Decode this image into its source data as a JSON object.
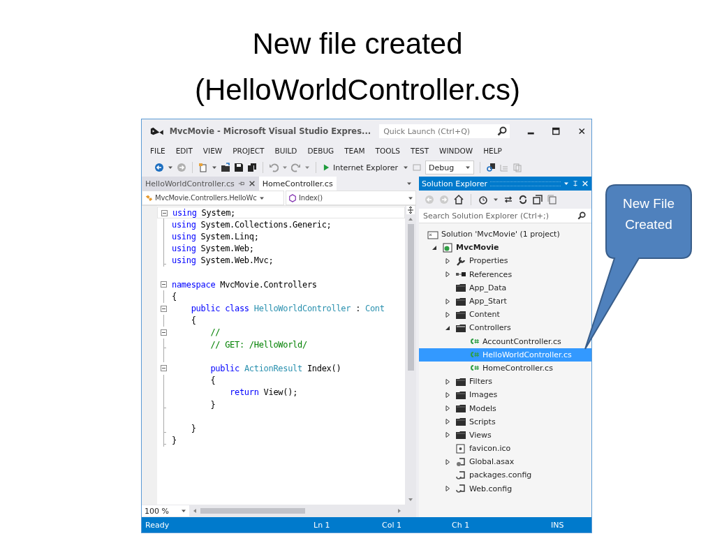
{
  "slide_title": [
    "New file created",
    "(HelloWorldController.cs)"
  ],
  "callout": "New File Created",
  "window": {
    "title": "MvcMovie - Microsoft Visual Studio Expres...",
    "quick_launch": {
      "placeholder": "Quick Launch (Ctrl+Q)"
    }
  },
  "menu": [
    "FILE",
    "EDIT",
    "VIEW",
    "PROJECT",
    "BUILD",
    "DEBUG",
    "TEAM",
    "TOOLS",
    "TEST",
    "WINDOW",
    "HELP"
  ],
  "toolbar": {
    "browser": "Internet Explorer",
    "configuration": "Debug"
  },
  "editor": {
    "tabs": [
      {
        "label": "HelloWorldController.cs",
        "selected": true
      },
      {
        "label": "HomeController.cs",
        "selected": false
      }
    ],
    "nav": {
      "type": "MvcMovie.Controllers.HelloWc",
      "member": "Index()"
    },
    "lines": [
      {
        "kind": "start",
        "tokens": [
          {
            "kind": "kw",
            "text": "using"
          },
          {
            "kind": "plain",
            "text": " System;"
          }
        ]
      },
      {
        "kind": "mid",
        "tokens": [
          {
            "kind": "kw",
            "text": "using"
          },
          {
            "kind": "plain",
            "text": " System.Collections.Generic;"
          }
        ]
      },
      {
        "kind": "mid",
        "tokens": [
          {
            "kind": "kw",
            "text": "using"
          },
          {
            "kind": "plain",
            "text": " System.Linq;"
          }
        ]
      },
      {
        "kind": "mid",
        "tokens": [
          {
            "kind": "kw",
            "text": "using"
          },
          {
            "kind": "plain",
            "text": " System.Web;"
          }
        ]
      },
      {
        "kind": "end",
        "tokens": [
          {
            "kind": "kw",
            "text": "using"
          },
          {
            "kind": "plain",
            "text": " System.Web.Mvc;"
          }
        ]
      },
      {
        "kind": "none"
      },
      {
        "kind": "start",
        "tokens": [
          {
            "kind": "kw",
            "text": "namespace"
          },
          {
            "kind": "plain",
            "text": " MvcMovie.Controllers"
          }
        ]
      },
      {
        "kind": "mid",
        "tokens": [
          {
            "kind": "plain",
            "text": "{"
          }
        ]
      },
      {
        "kind": "start",
        "tokens": [
          {
            "kind": "kw",
            "text": "    public class"
          },
          {
            "kind": "type",
            "text": " HelloWorldController"
          },
          {
            "kind": "plain",
            "text": " : "
          },
          {
            "kind": "type",
            "text": "Cont"
          }
        ]
      },
      {
        "kind": "mid",
        "tokens": [
          {
            "kind": "plain",
            "text": "    {"
          }
        ]
      },
      {
        "kind": "start",
        "tokens": [
          {
            "kind": "comment",
            "text": "        //"
          }
        ]
      },
      {
        "kind": "end",
        "tokens": [
          {
            "kind": "comment",
            "text": "        // GET: /HelloWorld/"
          }
        ]
      },
      {
        "kind": "mid"
      },
      {
        "kind": "start",
        "tokens": [
          {
            "kind": "kw",
            "text": "        public"
          },
          {
            "kind": "type",
            "text": " ActionResult"
          },
          {
            "kind": "plain",
            "text": " Index()"
          }
        ]
      },
      {
        "kind": "mid",
        "tokens": [
          {
            "kind": "plain",
            "text": "        {"
          }
        ]
      },
      {
        "kind": "mid",
        "tokens": [
          {
            "kind": "kw",
            "text": "            return"
          },
          {
            "kind": "plain",
            "text": " View();"
          }
        ]
      },
      {
        "kind": "end",
        "tokens": [
          {
            "kind": "plain",
            "text": "        }"
          }
        ]
      },
      {
        "kind": "mid"
      },
      {
        "kind": "end",
        "tokens": [
          {
            "kind": "plain",
            "text": "    }"
          }
        ]
      },
      {
        "kind": "end",
        "tokens": [
          {
            "kind": "plain",
            "text": "}"
          }
        ]
      }
    ],
    "zoom": "100 %"
  },
  "solution_explorer": {
    "title": "Solution Explorer",
    "search": {
      "placeholder": "Search Solution Explorer (Ctrl+;)"
    },
    "tree": [
      {
        "label": "Solution 'MvcMovie' (1 project)",
        "kind": "solution",
        "selected": false,
        "children": [
          {
            "label": "MvcMovie",
            "kind": "project",
            "expanded": true,
            "selected": false,
            "children": [
              {
                "label": "Properties",
                "kind": "properties",
                "expanded": false,
                "selected": false
              },
              {
                "label": "References",
                "kind": "references",
                "expanded": false,
                "selected": false
              },
              {
                "label": "App_Data",
                "kind": "folder",
                "selected": false
              },
              {
                "label": "App_Start",
                "kind": "folder",
                "expanded": false,
                "selected": false
              },
              {
                "label": "Content",
                "kind": "folder",
                "expanded": false,
                "selected": false
              },
              {
                "label": "Controllers",
                "kind": "open-folder",
                "expanded": true,
                "selected": false,
                "children": [
                  {
                    "label": "AccountController.cs",
                    "kind": "cs",
                    "selected": false
                  },
                  {
                    "label": "HelloWorldController.cs",
                    "kind": "cs",
                    "selected": true
                  },
                  {
                    "label": "HomeController.cs",
                    "kind": "cs",
                    "selected": false
                  }
                ]
              },
              {
                "label": "Filters",
                "kind": "folder",
                "expanded": false,
                "selected": false
              },
              {
                "label": "Images",
                "kind": "folder",
                "expanded": false,
                "selected": false
              },
              {
                "label": "Models",
                "kind": "folder",
                "expanded": false,
                "selected": false
              },
              {
                "label": "Scripts",
                "kind": "folder",
                "expanded": false,
                "selected": false
              },
              {
                "label": "Views",
                "kind": "folder",
                "expanded": false,
                "selected": false
              },
              {
                "label": "favicon.ico",
                "kind": "ico",
                "selected": false
              },
              {
                "label": "Global.asax",
                "kind": "asax",
                "expanded": false,
                "selected": false
              },
              {
                "label": "packages.config",
                "kind": "config",
                "selected": false
              },
              {
                "label": "Web.config",
                "kind": "config",
                "expanded": false,
                "selected": false
              }
            ]
          }
        ]
      }
    ]
  },
  "status_bar": {
    "state": "Ready",
    "line": "Ln 1",
    "column": "Col 1",
    "char": "Ch 1",
    "mode": "INS"
  }
}
